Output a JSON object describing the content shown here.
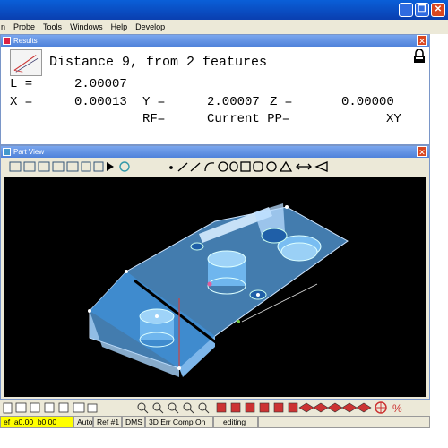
{
  "menu": [
    "n",
    "Probe",
    "Tools",
    "Windows",
    "Help",
    "Develop"
  ],
  "results": {
    "panel_title": "Results",
    "heading": "Distance 9, from 2 features",
    "l_label": "L =",
    "l_value": "2.00007",
    "x_label": "X =",
    "x_value": "0.00013",
    "y_label": "Y =",
    "y_value": "2.00007",
    "z_label": "Z =",
    "z_value": "0.00000",
    "rf_label": "RF=",
    "pp_label": "Current PP=",
    "pp_value": "XY"
  },
  "partview": {
    "panel_title": "Part View"
  },
  "status": {
    "item1": "ef_a0.00_b0.00",
    "item2": "Auto",
    "item3": "Ref #1",
    "item4": "DMS",
    "item5": "3D Err Comp On",
    "item6": "editing"
  },
  "colors": {
    "titlebar": "#0a4fc8",
    "part_fill": "#4f9fe4",
    "viewport_bg": "#000000",
    "status_highlight": "#ffff00"
  }
}
